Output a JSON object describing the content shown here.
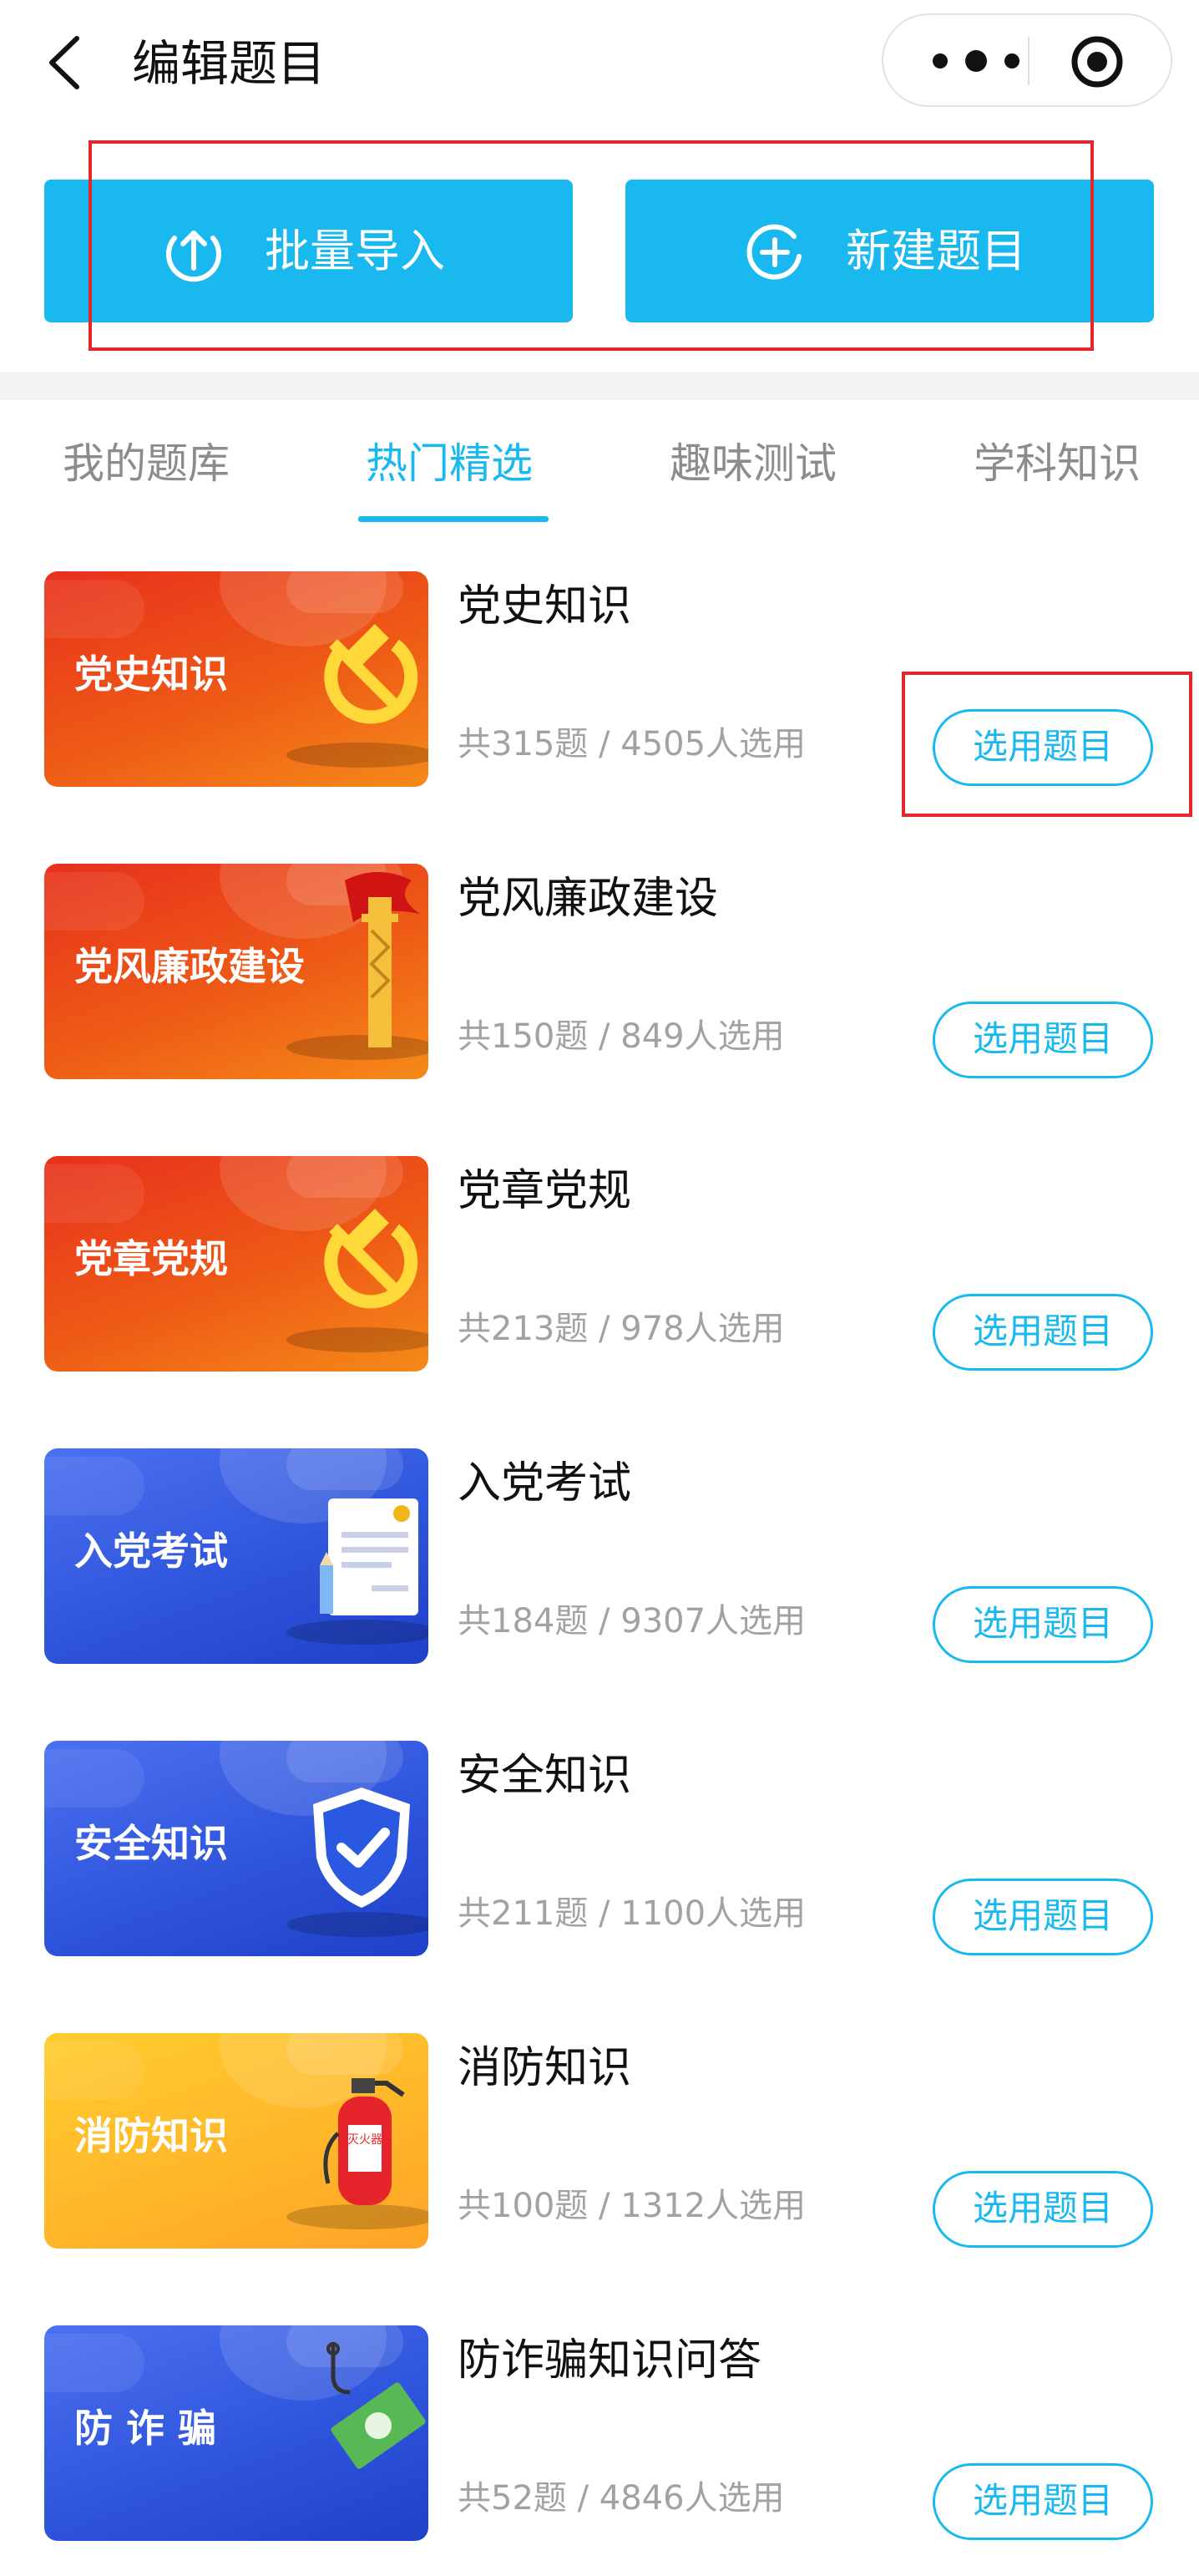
{
  "nav": {
    "title": "编辑题目",
    "back_icon": "chevron-left-icon",
    "more_icon": "more-dots-icon",
    "target_icon": "target-icon"
  },
  "actions": [
    {
      "label": "批量导入",
      "icon": "upload-circle-icon"
    },
    {
      "label": "新建题目",
      "icon": "plus-circle-icon"
    }
  ],
  "tabs": [
    {
      "label": "我的题库",
      "active": false
    },
    {
      "label": "热门精选",
      "active": true
    },
    {
      "label": "趣味测试",
      "active": false
    },
    {
      "label": "学科知识",
      "active": false
    }
  ],
  "items": [
    {
      "thumb_title": "党史知识",
      "title": "党史知识",
      "stats": "共315题 / 4505人选用",
      "button": "选用题目",
      "theme": "red",
      "pic": "hammer-sickle-icon"
    },
    {
      "thumb_title": "党风廉政建设",
      "title": "党风廉政建设",
      "stats": "共150题 / 849人选用",
      "button": "选用题目",
      "theme": "red",
      "pic": "flag-pillar-icon"
    },
    {
      "thumb_title": "党章党规",
      "title": "党章党规",
      "stats": "共213题 / 978人选用",
      "button": "选用题目",
      "theme": "red",
      "pic": "hammer-sickle-icon"
    },
    {
      "thumb_title": "入党考试",
      "title": "入党考试",
      "stats": "共184题 / 9307人选用",
      "button": "选用题目",
      "theme": "blue",
      "pic": "exam-paper-icon"
    },
    {
      "thumb_title": "安全知识",
      "title": "安全知识",
      "stats": "共211题 / 1100人选用",
      "button": "选用题目",
      "theme": "blue",
      "pic": "shield-check-icon"
    },
    {
      "thumb_title": "消防知识",
      "title": "消防知识",
      "stats": "共100题 / 1312人选用",
      "button": "选用题目",
      "theme": "yellow",
      "pic": "fire-extinguisher-icon",
      "pic_text": "灭火器"
    },
    {
      "thumb_title": "防 诈 骗",
      "title": "防诈骗知识问答",
      "stats": "共52题 / 4846人选用",
      "button": "选用题目",
      "theme": "blue",
      "pic": "money-hook-icon"
    }
  ],
  "colors": {
    "accent": "#19b9ef",
    "highlight_box": "#e3262b"
  }
}
